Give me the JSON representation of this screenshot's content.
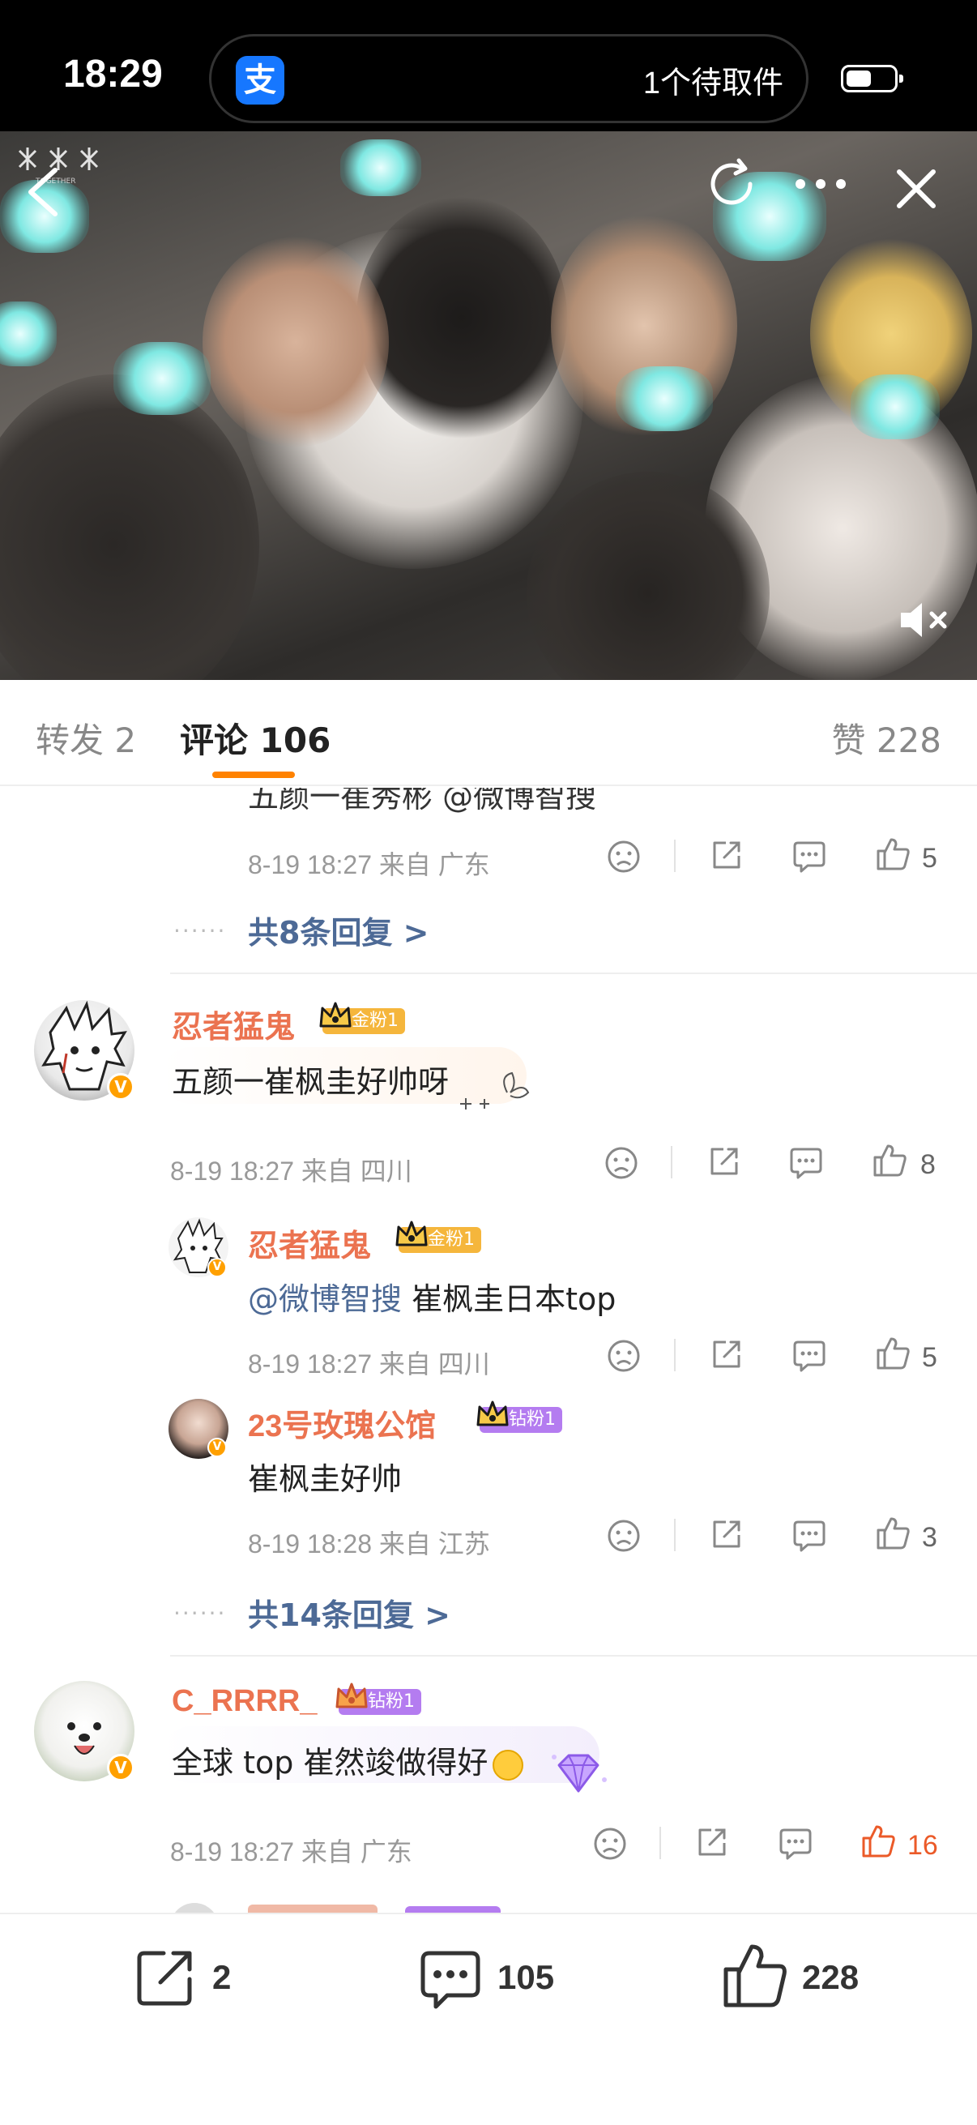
{
  "status_bar": {
    "time": "18:29",
    "app_icon": "支",
    "notification": "1个待取件"
  },
  "tabs": {
    "repost": "转发 2",
    "comments": "评论 106",
    "likes": "赞 228"
  },
  "thread1": {
    "partial_text": "五颜一崔秀彬 @微博智搜",
    "meta": "8-19 18:27 来自 广东",
    "like_count": "5",
    "more_replies": "共8条回复 >"
  },
  "comment1": {
    "name": "忍者猛鬼",
    "badge": "金粉1",
    "text": "五颜一崔枫圭好帅呀",
    "meta": "8-19 18:27 来自 四川",
    "like_count": "8",
    "replies": [
      {
        "name": "忍者猛鬼",
        "badge": "金粉1",
        "mention": "@微博智搜",
        "text": " 崔枫圭日本top",
        "meta": "8-19 18:27 来自 四川",
        "like_count": "5"
      },
      {
        "name": "23号玫瑰公馆",
        "badge": "钻粉1",
        "text": "崔枫圭好帅",
        "meta": "8-19 18:28 来自 江苏",
        "like_count": "3"
      }
    ],
    "more_replies": "共14条回复 >"
  },
  "comment2": {
    "name": "C_RRRR_",
    "badge": "钻粉1",
    "text": "全球 top 崔然竣做得好",
    "meta": "8-19 18:27 来自 广东",
    "like_count": "16"
  },
  "bottom_bar": {
    "repost_count": "2",
    "comment_count": "105",
    "like_count": "228"
  },
  "colors": {
    "accent": "#ff8200",
    "name": "#eb7350",
    "link": "#4d6a96",
    "gold_badge": "#f5b63c",
    "diamond_badge": "#b47cf0"
  }
}
